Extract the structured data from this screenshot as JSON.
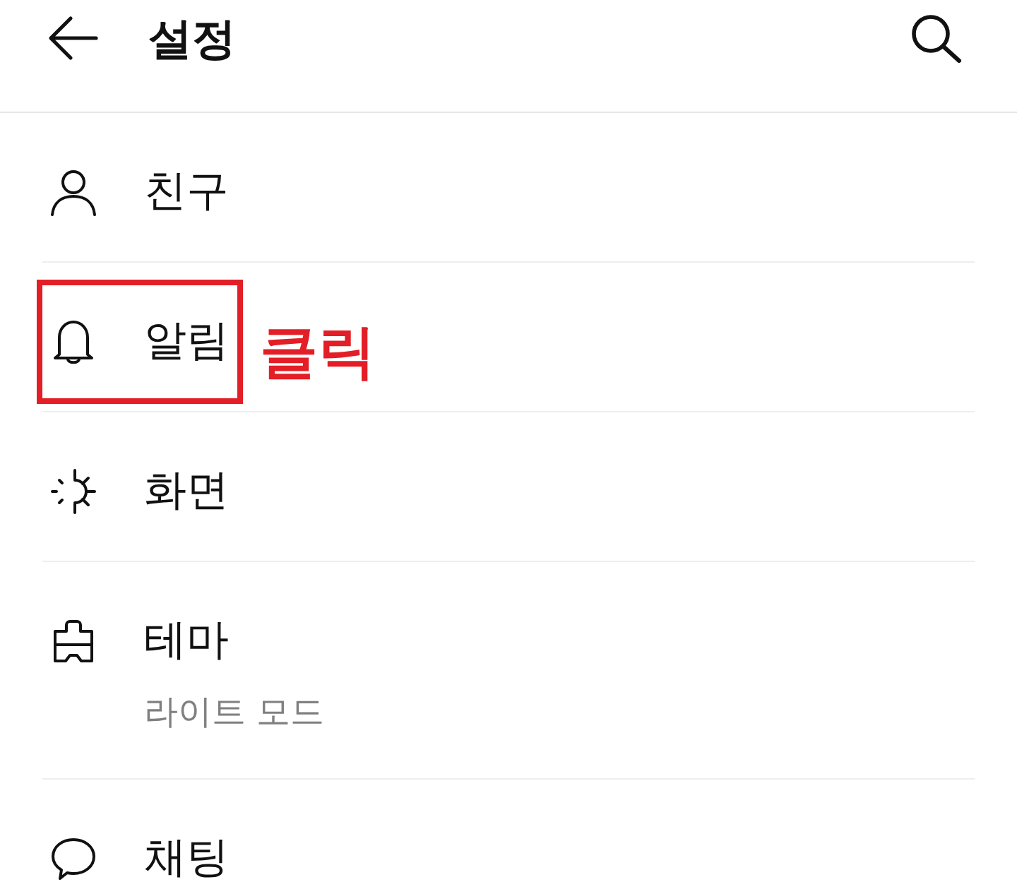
{
  "header": {
    "title": "설정"
  },
  "items": [
    {
      "label": "친구",
      "highlighted": false
    },
    {
      "label": "알림",
      "highlighted": true,
      "annotation": "클릭"
    },
    {
      "label": "화면",
      "highlighted": false
    },
    {
      "label": "테마",
      "subtitle": "라이트 모드",
      "highlighted": false
    },
    {
      "label": "채팅",
      "highlighted": false
    }
  ]
}
